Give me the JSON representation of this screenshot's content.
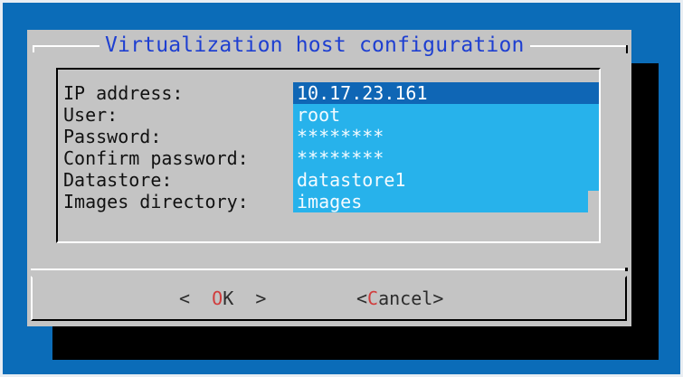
{
  "dialog": {
    "title": "Virtualization host configuration",
    "fields": [
      {
        "label": "IP address:",
        "value": "10.17.23.161"
      },
      {
        "label": "User:",
        "value": "root"
      },
      {
        "label": "Password:",
        "value": "********"
      },
      {
        "label": "Confirm password:",
        "value": "********"
      },
      {
        "label": "Datastore:",
        "value": "datastore1"
      },
      {
        "label": "Images directory:",
        "value": "images"
      }
    ]
  },
  "buttons": {
    "ok": {
      "left": "<",
      "hotkey": "O",
      "rest": "K",
      "right": ">"
    },
    "cancel": {
      "left": "<",
      "hotkey": "C",
      "rest": "ancel",
      "right": ">"
    }
  },
  "colors": {
    "background": "#0b6cb8",
    "dialog": "#c4c4c4",
    "title": "#1e3fd1",
    "field": "#27b2eb",
    "field_selected": "#0f66b5",
    "hotkey": "#d13c3c"
  }
}
